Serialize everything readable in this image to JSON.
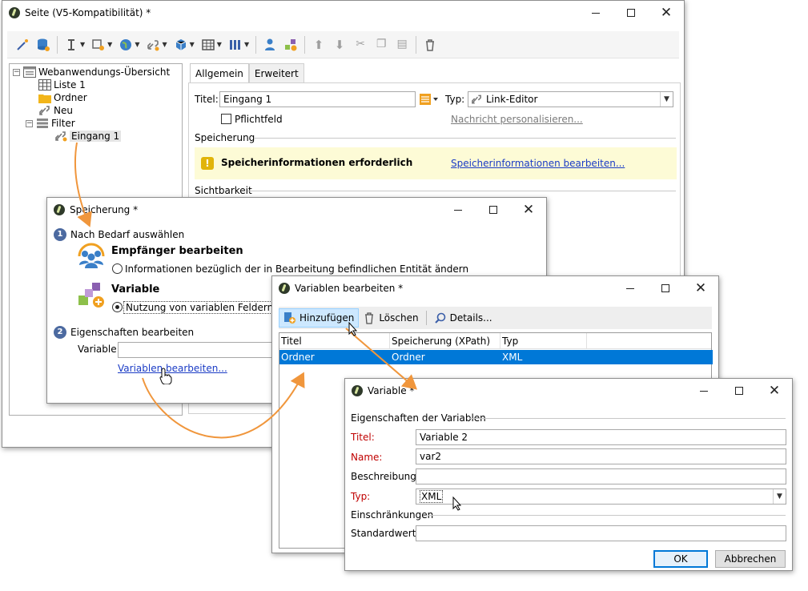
{
  "main_window": {
    "title": "Seite (V5-Kompatibilität) *",
    "tree": [
      {
        "label": "Webanwendungs-Übersicht"
      },
      {
        "label": "Liste 1"
      },
      {
        "label": "Ordner"
      },
      {
        "label": "Neu"
      },
      {
        "label": "Filter"
      },
      {
        "label": "Eingang 1"
      }
    ],
    "tabs": [
      "Allgemein",
      "Erweitert"
    ],
    "title_label": "Titel:",
    "title_value": "Eingang 1",
    "type_label": "Typ:",
    "type_value": "Link-Editor",
    "required_label": "Pflichtfeld",
    "personalize_link": "Nachricht personalisieren...",
    "section_storage": "Speicherung",
    "warning_text": "Speicherinformationen erforderlich",
    "warning_link": "Speicherinformationen bearbeiten...",
    "section_visibility": "Sichtbarkeit"
  },
  "speicherung_window": {
    "title": "Speicherung *",
    "step1_num": "1",
    "step1_label": "Nach Bedarf auswählen",
    "option1_title": "Empfänger bearbeiten",
    "option1_desc": "Informationen bezüglich der in Bearbeitung befindlichen Entität ändern",
    "option2_title": "Variable",
    "option2_desc": "Nutzung von variablen Feldern, der",
    "step2_num": "2",
    "step2_label": "Eigenschaften bearbeiten",
    "variable_label": "Variable:",
    "edit_link": "Variablen bearbeiten..."
  },
  "variablen_window": {
    "title": "Variablen bearbeiten *",
    "toolbar": {
      "add": "Hinzufügen",
      "delete": "Löschen",
      "details": "Details..."
    },
    "columns": [
      "Titel",
      "Speicherung (XPath)",
      "Typ"
    ],
    "rows": [
      {
        "title": "Ordner",
        "xpath": "Ordner",
        "type": "XML"
      }
    ]
  },
  "variable_window": {
    "title": "Variable *",
    "section_props": "Eigenschaften der Variablen",
    "title_label": "Titel:",
    "title_value": "Variable 2",
    "name_label": "Name:",
    "name_value": "var2",
    "desc_label": "Beschreibung:",
    "desc_value": "",
    "type_label": "Typ:",
    "type_value": "XML",
    "section_constraints": "Einschränkungen",
    "default_label": "Standardwert:",
    "default_value": "",
    "ok_label": "OK",
    "cancel_label": "Abbrechen"
  },
  "colors": {
    "arrow": "#f0963c",
    "selection": "#0078d7",
    "link": "#1a3bc5",
    "warning_bg": "#fdfbd6",
    "required": "#c00000"
  }
}
